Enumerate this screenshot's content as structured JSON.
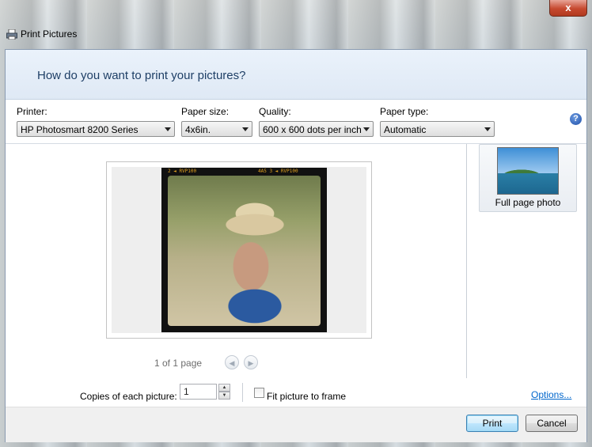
{
  "window": {
    "title": "Print Pictures",
    "close_glyph": "x"
  },
  "header": {
    "question": "How do you want to print your pictures?"
  },
  "printer": {
    "label": "Printer:",
    "value": "HP Photosmart 8200 Series"
  },
  "paper_size": {
    "label": "Paper size:",
    "value": "4x6in."
  },
  "quality": {
    "label": "Quality:",
    "value": "600 x 600 dots per inch"
  },
  "paper_type": {
    "label": "Paper type:",
    "value": "Automatic"
  },
  "help": {
    "glyph": "?"
  },
  "preview": {
    "page_count": "1 of 1 page",
    "film_left": "2 ◄ RVP100",
    "film_right": "4A5  3 ◄ RVP100"
  },
  "layouts": [
    {
      "label": "Full page photo"
    }
  ],
  "copies": {
    "label": "Copies of each picture:",
    "value": "1"
  },
  "fit": {
    "label": "Fit picture to frame",
    "checked": false
  },
  "options_link": "Options...",
  "buttons": {
    "print": "Print",
    "cancel": "Cancel"
  }
}
